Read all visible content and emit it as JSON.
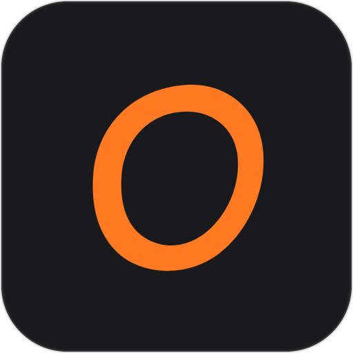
{
  "icon": {
    "name": "app-icon",
    "glyph": "ring-o-icon",
    "background_color": "#1a1a1c",
    "accent_color": "#ff7a22"
  }
}
